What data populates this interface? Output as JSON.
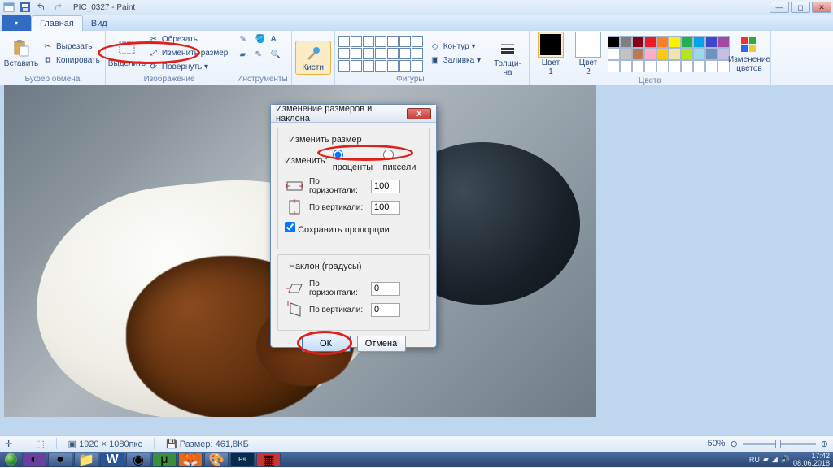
{
  "titlebar": {
    "filename": "PIC_0327 - Paint"
  },
  "tabs": {
    "file_drop": "▾",
    "home": "Главная",
    "view": "Вид"
  },
  "ribbon": {
    "clipboard": {
      "paste": "Вставить",
      "cut": "Вырезать",
      "copy": "Копировать",
      "group": "Буфер обмена"
    },
    "image": {
      "select": "Выделить",
      "crop": "Обрезать",
      "resize": "Изменить размер",
      "rotate": "Повернуть ▾",
      "group": "Изображение"
    },
    "tools": {
      "group": "Инструменты"
    },
    "brushes": {
      "label": "Кисти",
      "group": ""
    },
    "shapes": {
      "outline": "Контур ▾",
      "fill": "Заливка ▾",
      "group": "Фигуры"
    },
    "size": {
      "thickness": "Толщи-\nна",
      "color1": "Цвет\n1",
      "color2": "Цвет\n2",
      "editcolors": "Изменение\nцветов",
      "group": "Цвета"
    }
  },
  "palette_colors": [
    "#000",
    "#7f7f7f",
    "#880015",
    "#ed1c24",
    "#ff7f27",
    "#fff200",
    "#22b14c",
    "#00a2e8",
    "#3f48cc",
    "#a349a4",
    "#fff",
    "#c3c3c3",
    "#b97a57",
    "#ffaec9",
    "#ffc90e",
    "#efe4b0",
    "#b5e61d",
    "#99d9ea",
    "#7092be",
    "#c8bfe7"
  ],
  "dialog": {
    "title": "Изменение размеров и наклона",
    "resize_group": "Изменить размер",
    "by_label": "Изменить:",
    "percent": "проценты",
    "pixels": "пиксели",
    "horiz": "По горизонтали:",
    "vert": "По вертикали:",
    "h_val": "100",
    "v_val": "100",
    "keep": "Сохранить пропорции",
    "skew_group": "Наклон (градусы)",
    "sh_val": "0",
    "sv_val": "0",
    "ok": "ОК",
    "cancel": "Отмена"
  },
  "statusbar": {
    "dims": "1920 × 1080пкс",
    "size": "Размер: 461,8КБ",
    "zoom": "50%"
  },
  "tray": {
    "lang": "RU",
    "time": "17:42",
    "date": "08.06.2018"
  }
}
